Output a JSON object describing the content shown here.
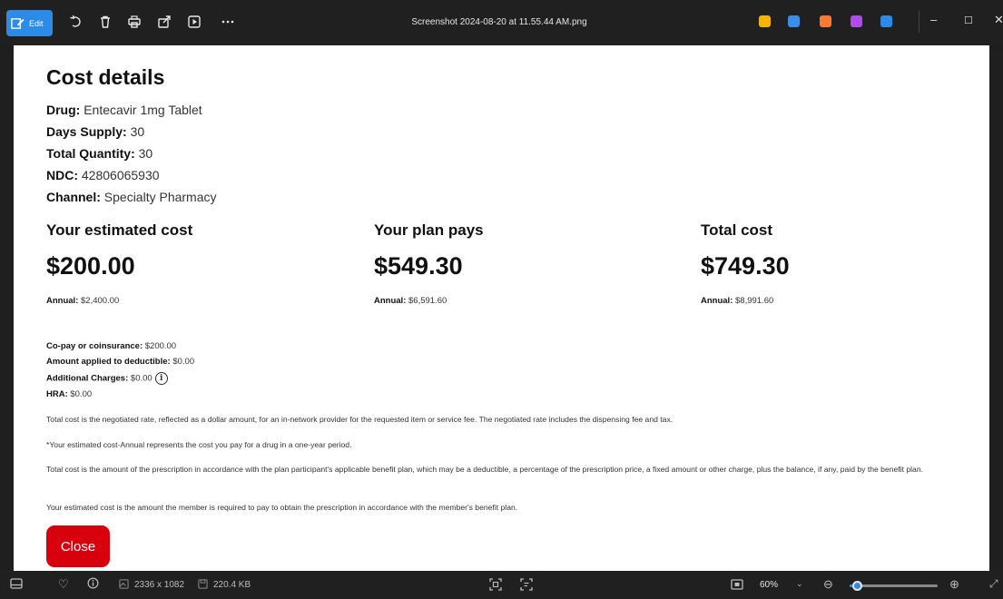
{
  "titlebar": {
    "edit_label": "Edit",
    "title": "Screenshot 2024-08-20 at 11.55.44 AM.png",
    "app_icon_colors": [
      "#f4b400",
      "#3a8ee6",
      "#ff7a2f",
      "#b04bf0",
      "#2b8be6"
    ],
    "icons": [
      "rotate-icon",
      "delete-icon",
      "print-icon",
      "share-icon",
      "slideshow-icon",
      "more-icon"
    ]
  },
  "content": {
    "title": "Cost details",
    "info": [
      {
        "label": "Drug:",
        "value": "Entecavir 1mg Tablet"
      },
      {
        "label": "Days Supply:",
        "value": "30"
      },
      {
        "label": "Total Quantity:",
        "value": "30"
      },
      {
        "label": "NDC:",
        "value": "42806065930"
      },
      {
        "label": "Channel:",
        "value": "Specialty Pharmacy"
      }
    ],
    "columns": [
      {
        "heading": "Your estimated cost",
        "amount": "$200.00",
        "annual_label": "Annual:",
        "annual_value": "$2,400.00"
      },
      {
        "heading": "Your plan pays",
        "amount": "$549.30",
        "annual_label": "Annual:",
        "annual_value": "$6,591.60"
      },
      {
        "heading": "Total cost",
        "amount": "$749.30",
        "annual_label": "Annual:",
        "annual_value": "$8,991.60"
      }
    ],
    "breakdown": [
      {
        "label": "Co-pay or coinsurance:",
        "value": "$200.00"
      },
      {
        "label": "Amount applied to deductible:",
        "value": "$0.00"
      },
      {
        "label": "Additional Charges:",
        "value": "$0.00"
      },
      {
        "label": "HRA:",
        "value": "$0.00"
      }
    ],
    "info_icon_glyph": "i",
    "notes": [
      "Total cost is the negotiated rate, reflected as a dollar amount, for an in-network provider for the requested item or service fee. The negotiated rate includes the dispensing fee and tax.",
      "*Your estimated cost-Annual represents the cost you pay for a drug in a one-year period.",
      "Total cost is the amount of the prescription in accordance with the plan participant's applicable benefit plan, which may be a deductible, a percentage of the prescription price, a fixed amount or other charge, plus the balance, if any, paid by the benefit plan.",
      "Your estimated cost is the amount the member is required to pay to obtain the prescription in accordance with the member's benefit plan."
    ],
    "close_label": "Close"
  },
  "statusbar": {
    "dimensions": "2336 x 1082",
    "file_size": "220.4 KB",
    "zoom": "60%",
    "zoom_fraction": 0.08
  },
  "colors": {
    "accent": "#2b8be6",
    "close_button": "#d9000d",
    "chrome_bg": "#202020"
  }
}
